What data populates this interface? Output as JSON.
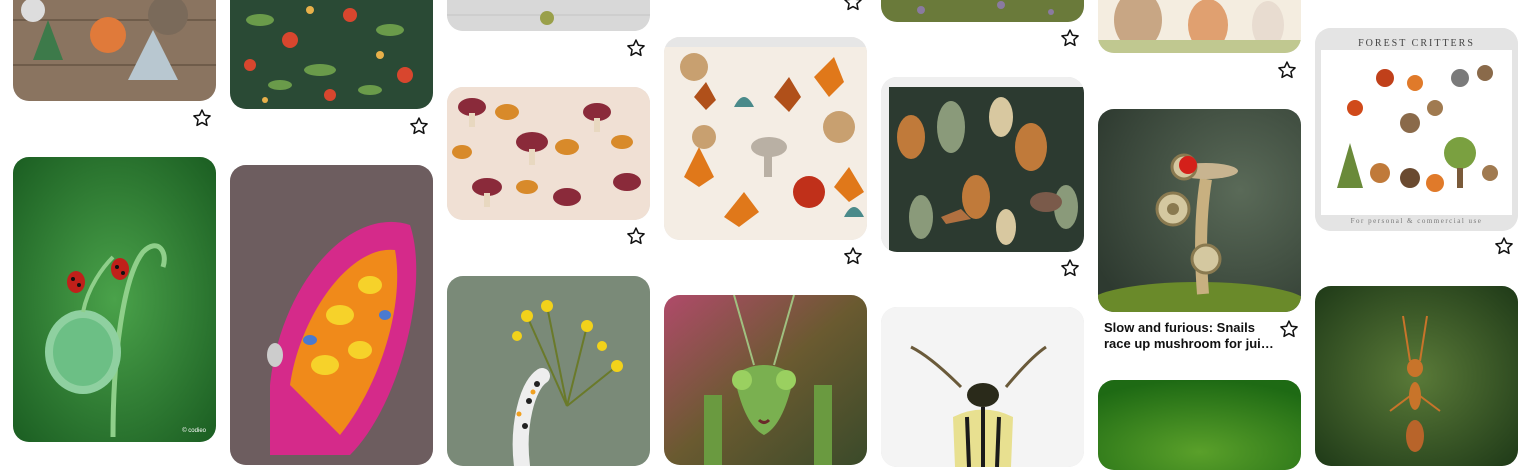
{
  "pins": [
    {
      "name": "felt-woodland-animals",
      "image": "felt woodland animal garland on wooden boards"
    },
    {
      "name": "mushroom-foliage-fabric",
      "image": "dark green fabric with red mushrooms and foliage"
    },
    {
      "name": "white-wood-ornament",
      "image": "ornament on white painted wood"
    },
    {
      "name": "mushroom-pattern-fabric",
      "image": "red and orange toadstool fabric pattern"
    },
    {
      "name": "autumn-leaves-fabric",
      "image": "autumn leaves, acorns and mushrooms fabric"
    },
    {
      "name": "meadow-photo",
      "image": "meadow photo"
    },
    {
      "name": "forest-animals-fabric",
      "image": "dark forest with deer and boar fabric"
    },
    {
      "name": "watercolor-woodland-animals",
      "image": "watercolor bear, fox and bunny"
    },
    {
      "name": "forest-critters-clipart",
      "image": "forest critters clipart sheet",
      "title": "FOREST CRITTERS",
      "footer": "For personal & commercial use"
    },
    {
      "name": "ladybugs-poppy-bud",
      "image": "two ladybugs on a hairy poppy bud",
      "watermark": "© codieo"
    },
    {
      "name": "colorful-butterfly",
      "image": "iridescent orange and magenta butterfly"
    },
    {
      "name": "caterpillar-yellow-flower",
      "image": "caterpillar on yellow flower"
    },
    {
      "name": "praying-mantis",
      "image": "green praying mantis"
    },
    {
      "name": "striped-beetle",
      "image": "yellow striped longhorn beetle"
    },
    {
      "name": "snail-mushroom",
      "image": "snail climbing a mushroom toward a berry",
      "caption_line1": "Slow and furious: Snails",
      "caption_line2": "race up mushroom for juic..."
    },
    {
      "name": "green-bokeh",
      "image": "green blurred nature photo"
    },
    {
      "name": "standing-ant",
      "image": "orange ant standing upright"
    }
  ],
  "icons": {
    "save": "star-outline-icon"
  },
  "colors": {
    "icon": "#111111",
    "background": "#ffffff"
  }
}
